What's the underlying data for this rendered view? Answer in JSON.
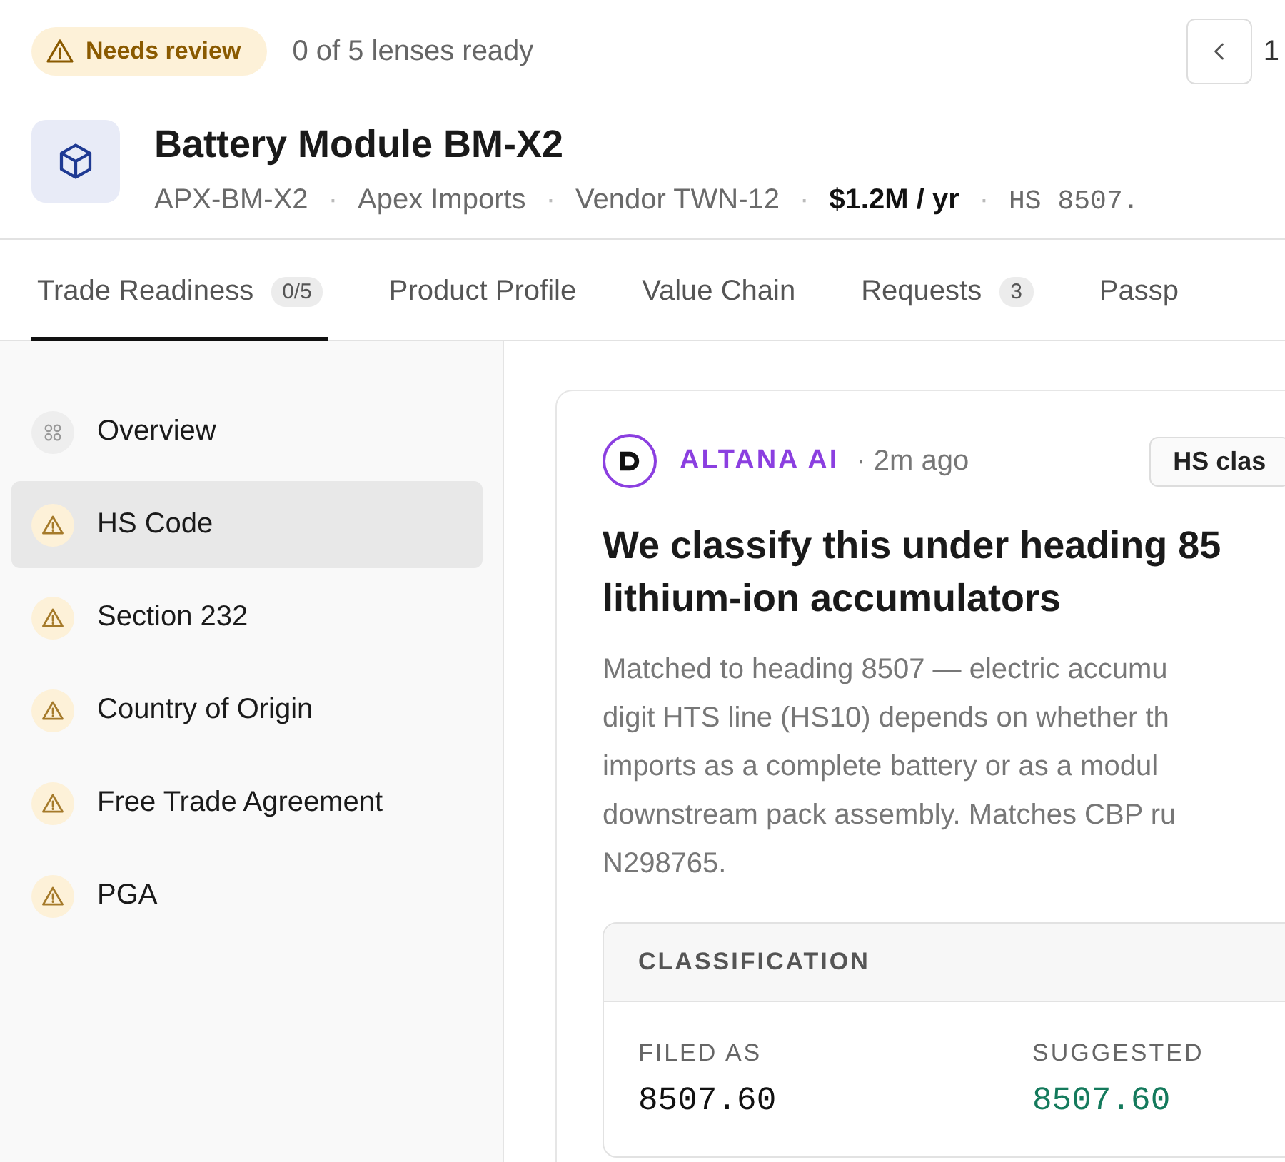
{
  "status": {
    "badge": {
      "label": "Needs review",
      "kind": "warning"
    },
    "progress": "0 of 5 lenses ready"
  },
  "pager": {
    "current": "1"
  },
  "product": {
    "title": "Battery Module BM-X2",
    "separator": "·",
    "meta": [
      {
        "text": "APX-BM-X2",
        "kind": "plain"
      },
      {
        "text": "Apex Imports",
        "kind": "plain"
      },
      {
        "text": "Vendor TWN-12",
        "kind": "plain"
      },
      {
        "text": "$1.2M / yr",
        "kind": "strong"
      },
      {
        "text": "HS 8507.",
        "kind": "mono"
      }
    ]
  },
  "tabs": [
    {
      "label": "Trade Readiness",
      "count": "0/5",
      "selected": true
    },
    {
      "label": "Product Profile",
      "selected": false
    },
    {
      "label": "Value Chain",
      "selected": false
    },
    {
      "label": "Requests",
      "count": "3",
      "selected": false
    },
    {
      "label": "Passp",
      "selected": false
    }
  ],
  "sidebar": {
    "items": [
      {
        "label": "Overview",
        "kind": "overview",
        "selected": false
      },
      {
        "label": "HS Code",
        "kind": "warning",
        "selected": true
      },
      {
        "label": "Section 232",
        "kind": "warning",
        "selected": false
      },
      {
        "label": "Country of Origin",
        "kind": "warning",
        "selected": false
      },
      {
        "label": "Free Trade Agreement",
        "kind": "warning",
        "selected": false
      },
      {
        "label": "PGA",
        "kind": "warning",
        "selected": false
      }
    ]
  },
  "card": {
    "author": "ALTANA AI",
    "time": "· 2m ago",
    "tag": "HS clas",
    "heading_lines": [
      "We classify this under heading 85",
      "lithium-ion accumulators"
    ],
    "body_lines": [
      "Matched to heading 8507 — electric accumu",
      "digit HTS line (HS10) depends on whether th",
      "imports as a complete battery or as a modul",
      "downstream pack assembly. Matches CBP ru",
      "N298765."
    ],
    "classification": {
      "title": "CLASSIFICATION",
      "fields": [
        {
          "label": "FILED AS",
          "value": "8507.60",
          "kind": "filed"
        },
        {
          "label": "SUGGESTED",
          "value": "8507.60",
          "kind": "suggested"
        }
      ]
    }
  }
}
